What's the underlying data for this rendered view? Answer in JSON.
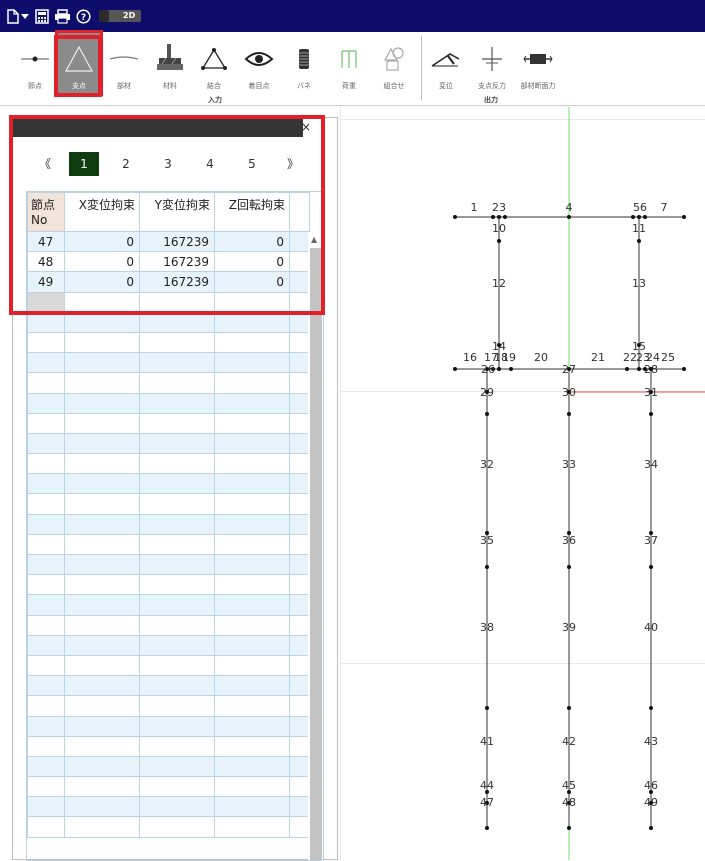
{
  "toolbar": {
    "toggle_label": "2D",
    "input_group_label": "入力",
    "output_group_label": "出力",
    "tools": [
      {
        "label": "節点",
        "icon": "node-icon"
      },
      {
        "label": "支点",
        "icon": "support-icon",
        "active": true
      },
      {
        "label": "部材",
        "icon": "member-icon"
      },
      {
        "label": "材料",
        "icon": "material-icon"
      },
      {
        "label": "結合",
        "icon": "joint-icon"
      },
      {
        "label": "着目点",
        "icon": "eye-icon"
      },
      {
        "label": "バネ",
        "icon": "spring-icon"
      },
      {
        "label": "荷重",
        "icon": "load-icon"
      },
      {
        "label": "組合せ",
        "icon": "combination-icon"
      },
      {
        "label": "変位",
        "icon": "displacement-icon"
      },
      {
        "label": "支点反力",
        "icon": "reaction-icon"
      },
      {
        "label": "部材断面力",
        "icon": "section-force-icon"
      }
    ]
  },
  "panel": {
    "close": "×",
    "pager": [
      "《",
      "1",
      "2",
      "3",
      "4",
      "5",
      "》"
    ],
    "active_page": "1",
    "headers": [
      "節点\nNo",
      "X変位拘束",
      "Y変位拘束",
      "Z回転拘束"
    ],
    "rows": [
      [
        "47",
        "0",
        "167239",
        "0"
      ],
      [
        "48",
        "0",
        "167239",
        "0"
      ],
      [
        "49",
        "0",
        "167239",
        "0"
      ]
    ]
  },
  "model": {
    "node_labels": [
      "1",
      "23",
      "4",
      "56",
      "7",
      "10",
      "11",
      "12",
      "13",
      "14",
      "15",
      "16",
      "17",
      "18",
      "19",
      "20",
      "21",
      "22",
      "23",
      "24",
      "25",
      "26",
      "27",
      "28",
      "29",
      "30",
      "31",
      "32",
      "33",
      "34",
      "35",
      "36",
      "37",
      "38",
      "39",
      "40",
      "41",
      "42",
      "43",
      "44",
      "45",
      "46",
      "47",
      "48",
      "49"
    ]
  }
}
